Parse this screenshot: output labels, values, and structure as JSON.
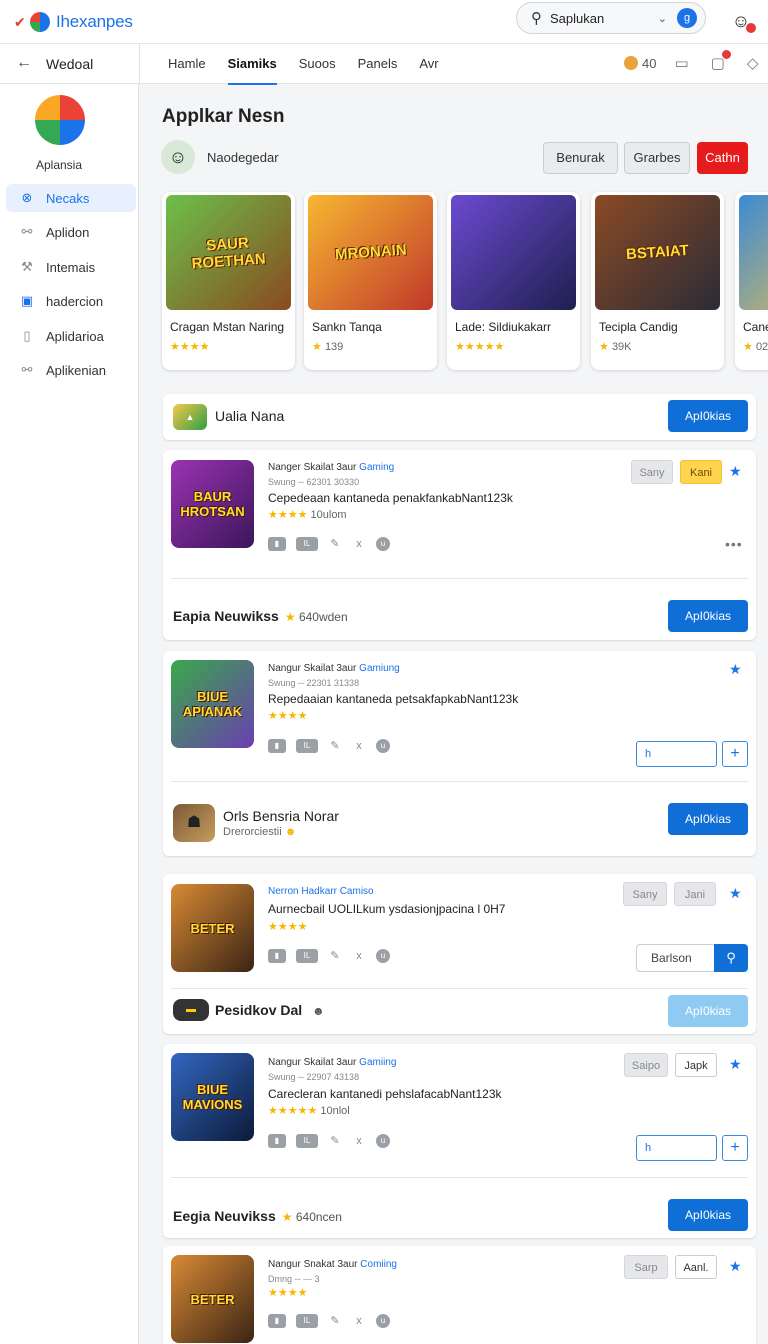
{
  "topbar": {
    "brand": "Ihexanpes",
    "search_label": "Saplukan",
    "search_badge": "g"
  },
  "navbar": {
    "title": "Wedoal",
    "tabs": [
      "Hamle",
      "Siamiks",
      "Suoos",
      "Panels",
      "Avr"
    ],
    "active_tab": 1,
    "coins": "40"
  },
  "sidebar": {
    "app_name": "Aplansia",
    "items": [
      {
        "label": "Necaks",
        "icon": "compass-icon",
        "active": true
      },
      {
        "label": "Aplidon",
        "icon": "link-icon"
      },
      {
        "label": "Intemais",
        "icon": "tools-icon"
      },
      {
        "label": "hadercion",
        "icon": "grid-icon"
      },
      {
        "label": "Aplidarioa",
        "icon": "page-icon"
      },
      {
        "label": "Aplikenian",
        "icon": "link-icon"
      }
    ]
  },
  "header": {
    "title": "Applkar Nesn",
    "developer": "Naodegedar",
    "buttons": [
      "Benurak",
      "Grarbes",
      "Cathn"
    ]
  },
  "featured": [
    {
      "art": "SAUR\nROETHAN",
      "title": "Cragan Mstan Naring",
      "meta": "",
      "stars": 4,
      "colors": [
        "#5aa14a",
        "#d27b2c"
      ]
    },
    {
      "art": "MRONAIN",
      "title": "Sankn Tanqa",
      "meta": "139",
      "stars": 1,
      "colors": [
        "#f39a1f",
        "#c6341d"
      ]
    },
    {
      "art": "",
      "title": "Lade: Sildiukakarr",
      "meta": "",
      "stars": 5,
      "colors": [
        "#5c3ba8",
        "#1c1b4a"
      ]
    },
    {
      "art": "BSTAIAT",
      "title": "Tecipla Candig",
      "meta": "39K",
      "stars": 1,
      "colors": [
        "#7a3a20",
        "#2a2b35"
      ]
    },
    {
      "art": "",
      "title": "Cane",
      "meta": "02",
      "stars": 1,
      "colors": [
        "#3b8ad6",
        "#f4c34a"
      ]
    }
  ],
  "sections": {
    "s1_title": "Ualia Nana",
    "action": "ApI0kias",
    "s2_title": "Eapia Neuwikss",
    "s2_meta": "640wden",
    "s3_title": "Orls Bensria Norar",
    "s3_sub": "Drerorciestii",
    "s4_title": "Pesidkov Dal",
    "s5_title": "Eegia Neuvikss",
    "s5_meta": "640ncen"
  },
  "apps": [
    {
      "art": "BAUR\nHROTSAN",
      "dev": "Nanger Skailat",
      "dev_suffix": "3aur",
      "dev_tag": "Gaming",
      "line2": "Swung -- 62301 30330",
      "desc": "Cepedeaan kantaneda penakfankabNant123k",
      "stars": 3,
      "rating": "10ulom",
      "tags": [
        "Sany",
        "Kani"
      ],
      "colors": [
        "#8e2fa0",
        "#3b1659"
      ]
    },
    {
      "art": "BIUE\nAPIANAK",
      "dev": "Nangur Skailat",
      "dev_suffix": "3aur",
      "dev_tag": "Gamiung",
      "line2": "Swung -- 22301 31338",
      "desc": "Repedaaian kantaneda petsakfapkabNant123k",
      "stars": 4,
      "rating": "",
      "input": "h",
      "colors": [
        "#2f9e44",
        "#6a3fb0"
      ]
    },
    {
      "art": "BETER",
      "dev": "Nerron Hadkarr",
      "dev_tag": "Camiso",
      "desc": "Aurnecbail UOLILkum ysdasionjpacina l 0H7",
      "stars": 4,
      "tags": [
        "Sany",
        "Jani"
      ],
      "search_value": "Barlson",
      "colors": [
        "#c97a2a",
        "#3a2414"
      ]
    },
    {
      "art": "BIUE\nMAVIONS",
      "dev": "Nangur Skailat",
      "dev_suffix": "3aur",
      "dev_tag": "Gamiing",
      "line2": "Swung -- 22907 43138",
      "desc": "Carecleran kantanedi pehslafacabNant123k",
      "stars": 5,
      "rating": "10nlol",
      "tags": [
        "Saipo",
        "Japk"
      ],
      "input": "h",
      "colors": [
        "#2a5aa8",
        "#0c1b3a"
      ]
    },
    {
      "art": "BETER",
      "dev": "Nangur Snakat",
      "dev_suffix": "3aur",
      "dev_tag": "Comiing",
      "line2": "Dmng -- --- 3",
      "desc": "",
      "stars": 4,
      "tags": [
        "Sarp",
        "Aanl."
      ],
      "colors": [
        "#c97a2a",
        "#3a2414"
      ]
    }
  ]
}
